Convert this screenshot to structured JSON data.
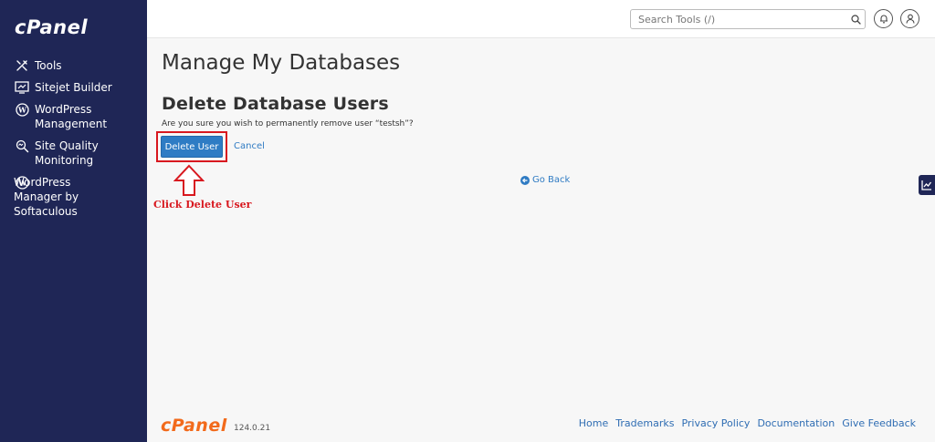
{
  "brand": {
    "logo_text": "cPanel",
    "footer_logo_text": "cPanel",
    "version": "124.0.21",
    "accent": "#f26a1b",
    "sidebar_bg": "#1f2656"
  },
  "sidebar": {
    "items": [
      {
        "label": "Tools",
        "icon": "tools-icon"
      },
      {
        "label": "Sitejet Builder",
        "icon": "sitejet-icon"
      },
      {
        "label": "WordPress\nManagement",
        "icon": "wordpress-icon"
      },
      {
        "label": "Site Quality\nMonitoring",
        "icon": "site-quality-icon"
      },
      {
        "label": "WordPress\n     Manager by\nSoftaculous",
        "icon": "wordpress-icon"
      }
    ]
  },
  "header": {
    "search_placeholder": "Search Tools (/)"
  },
  "main": {
    "page_title": "Manage My Databases",
    "section_title": "Delete Database Users",
    "confirm_text": "Are you sure you wish to permanently remove user “testsh”?",
    "delete_button": "Delete User",
    "cancel_link": "Cancel",
    "go_back": "Go Back",
    "annotation": "Click Delete User",
    "highlight_color": "#d8181f",
    "button_color": "#2e7cc4"
  },
  "footer": {
    "links": [
      "Home",
      "Trademarks",
      "Privacy Policy",
      "Documentation",
      "Give Feedback"
    ]
  }
}
